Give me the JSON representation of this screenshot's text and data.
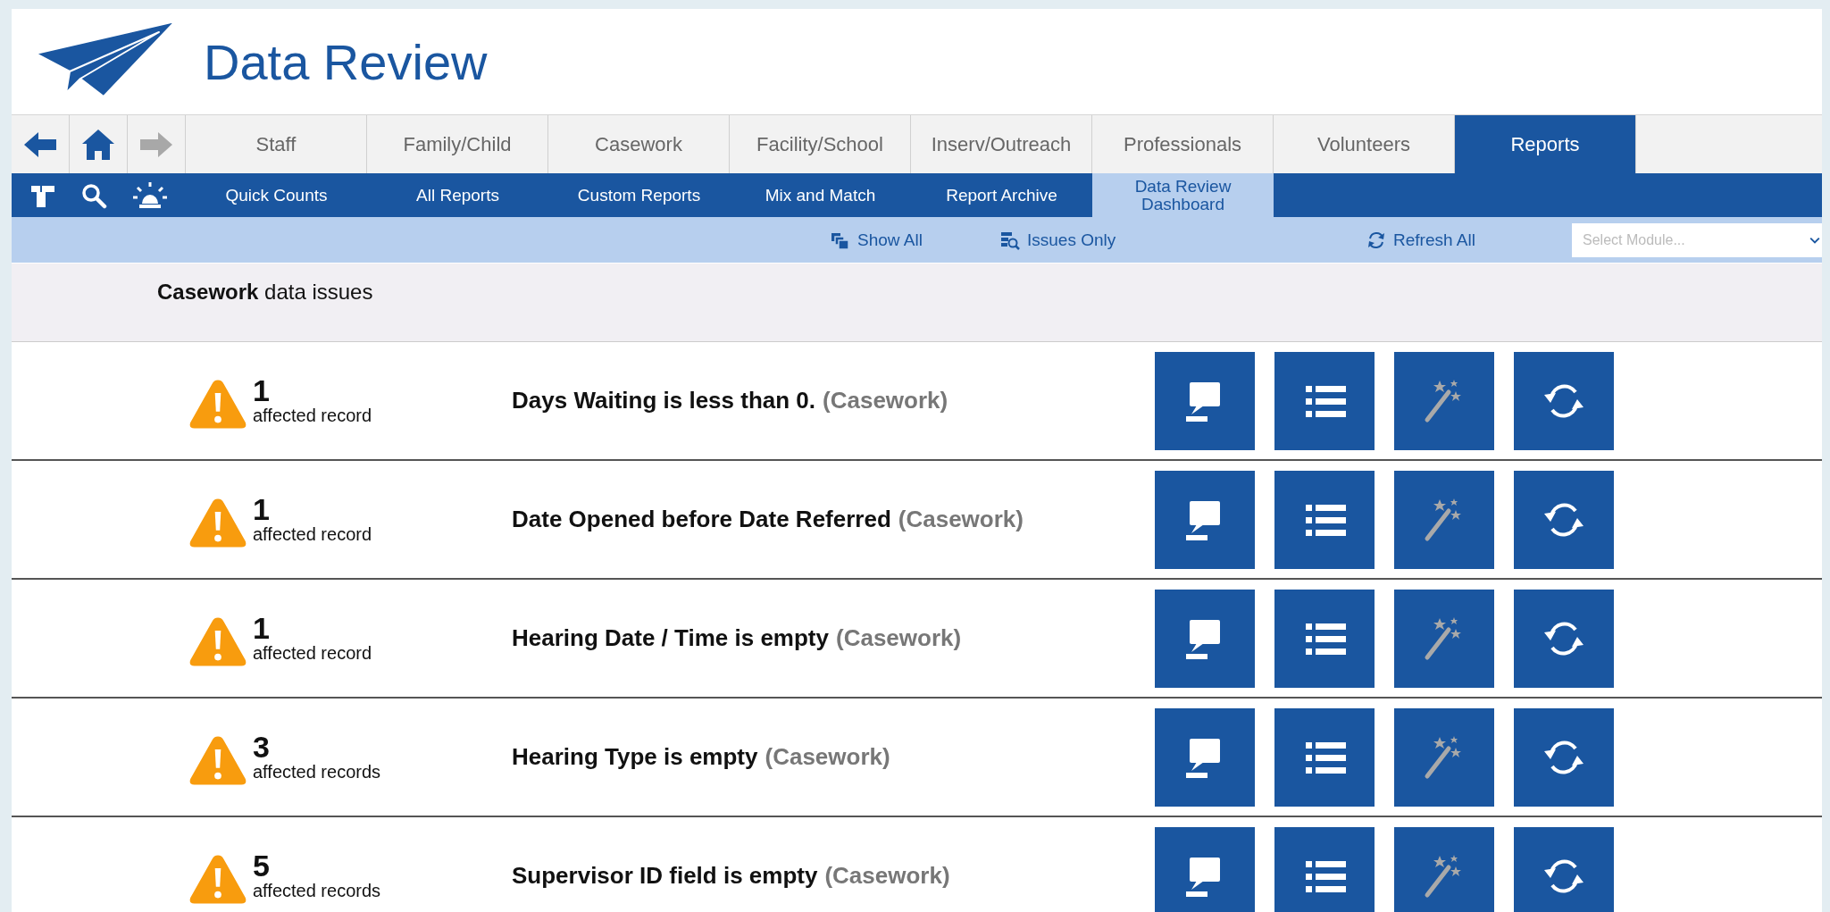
{
  "header": {
    "title": "Data Review"
  },
  "nav_tabs": [
    {
      "label": "Staff",
      "selected": false
    },
    {
      "label": "Family/Child",
      "selected": false
    },
    {
      "label": "Casework",
      "selected": false
    },
    {
      "label": "Facility/School",
      "selected": false
    },
    {
      "label": "Inserv/Outreach",
      "selected": false
    },
    {
      "label": "Professionals",
      "selected": false
    },
    {
      "label": "Volunteers",
      "selected": false
    },
    {
      "label": "Reports",
      "selected": true
    }
  ],
  "sub_nav": [
    {
      "label": "Quick Counts",
      "selected": false
    },
    {
      "label": "All Reports",
      "selected": false
    },
    {
      "label": "Custom Reports",
      "selected": false
    },
    {
      "label": "Mix and Match",
      "selected": false
    },
    {
      "label": "Report Archive",
      "selected": false
    },
    {
      "label": "Data Review Dashboard",
      "selected": true
    }
  ],
  "toolbar": {
    "actions": [
      {
        "kind": "show",
        "label": "Show All"
      },
      {
        "kind": "issues",
        "label": "Issues Only"
      },
      {
        "kind": "refresh",
        "label": "Refresh All"
      }
    ],
    "module_select": {
      "placeholder": "Select Module..."
    }
  },
  "section": {
    "heading": "**Casework** data issues"
  },
  "issues": [
    {
      "count": "1",
      "count_label": "affected record",
      "title": "Days Waiting is less than 0.",
      "module": "(Casework)"
    },
    {
      "count": "1",
      "count_label": "affected record",
      "title": "Date Opened before Date Referred",
      "module": "(Casework)"
    },
    {
      "count": "1",
      "count_label": "affected record",
      "title": "Hearing Date / Time is empty",
      "module": "(Casework)"
    },
    {
      "count": "3",
      "count_label": "affected records",
      "title": "Hearing Type is empty",
      "module": "(Casework)"
    },
    {
      "count": "5",
      "count_label": "affected records",
      "title": "Supervisor ID field is empty",
      "module": "(Casework)"
    }
  ]
}
